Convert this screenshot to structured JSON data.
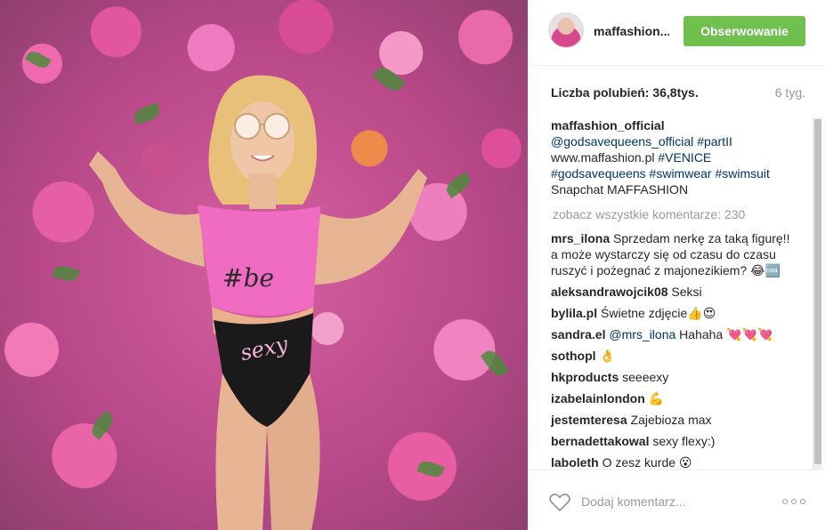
{
  "post": {
    "username": "maffashion...",
    "follow_label": "Obserwowanie",
    "likes": "Liczba polubień: 36,8tys.",
    "age": "6 tyg.",
    "caption": {
      "author": "maffashion_official",
      "parts": [
        {
          "type": "mention",
          "text": "@godsavequeens_official"
        },
        {
          "type": "tag",
          "text": "#partII"
        },
        {
          "type": "text",
          "text": "www.maffashion.pl"
        },
        {
          "type": "tag",
          "text": "#VENICE"
        },
        {
          "type": "tag",
          "text": "#godsavequeens"
        },
        {
          "type": "tag",
          "text": "#swimwear"
        },
        {
          "type": "tag",
          "text": "#swimsuit"
        },
        {
          "type": "text",
          "text": "Snapchat MAFFASHION"
        }
      ]
    },
    "view_all": "zobacz wszystkie komentarze: 230",
    "comments": [
      {
        "author": "mrs_ilona",
        "text": "Sprzedam nerkę za taką figurę!! a może wystarczy się od czasu do czasu ruszyć i pożegnać z majonezikiem? 😂🆒"
      },
      {
        "author": "aleksandrawojcik08",
        "text": "Seksi"
      },
      {
        "author": "bylila.pl",
        "text": "Świetne zdjęcie👍😍"
      },
      {
        "author": "sandra.el",
        "mention": "@mrs_ilona",
        "text": "Hahaha 💘💘💘"
      },
      {
        "author": "sothopl",
        "text": "👌"
      },
      {
        "author": "hkproducts",
        "text": "seeeexy"
      },
      {
        "author": "izabelainlondon",
        "text": "💪"
      },
      {
        "author": "jestemteresa",
        "text": "Zajebioza max"
      },
      {
        "author": "bernadettakowal",
        "text": "sexy flexy:)"
      },
      {
        "author": "laboleth",
        "text": "O zesz kurde 😮"
      }
    ],
    "add_comment_placeholder": "Dodaj komentarz...",
    "photo_print": {
      "top": "#be",
      "bottom": "sexy"
    }
  },
  "icons": {
    "heart": "heart-icon",
    "more": "more-options-icon"
  },
  "colors": {
    "follow_bg": "#70c050",
    "link": "#003569",
    "muted": "#999999",
    "text": "#262626"
  }
}
